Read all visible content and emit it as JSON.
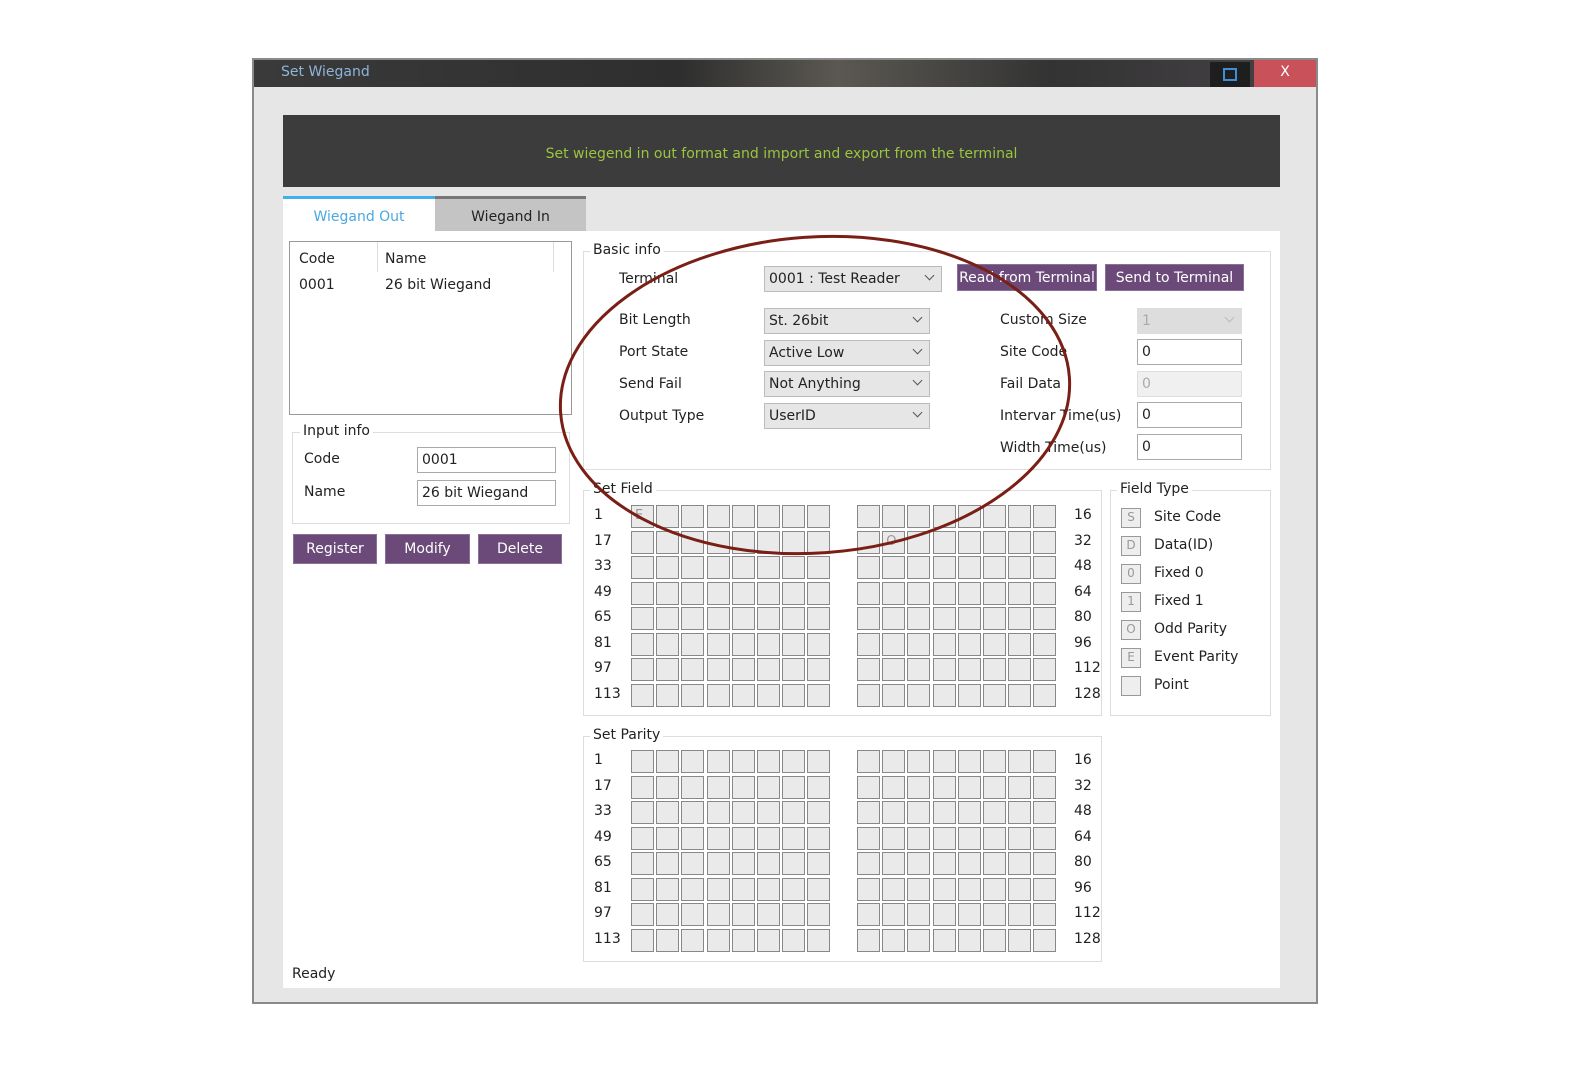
{
  "window": {
    "title": "Set Wiegand",
    "close_label": "X"
  },
  "header": {
    "text": "Set wiegend in  out format and import and export from the terminal"
  },
  "tabs": [
    {
      "label": "Wiegand Out",
      "active": true
    },
    {
      "label": "Wiegand In",
      "active": false
    }
  ],
  "list": {
    "columns": [
      "Code",
      "Name"
    ],
    "rows": [
      {
        "code": "0001",
        "name": "26 bit Wiegand"
      }
    ]
  },
  "input_info": {
    "legend": "Input info",
    "code_label": "Code",
    "code_value": "0001",
    "name_label": "Name",
    "name_value": "26 bit Wiegand"
  },
  "actions": {
    "register": "Register",
    "modify": "Modify",
    "delete": "Delete"
  },
  "basic_info": {
    "legend": "Basic info",
    "terminal_label": "Terminal",
    "terminal_value": "0001 : Test Reader",
    "read_button": "Read from Terminal",
    "send_button": "Send to Terminal",
    "bit_length_label": "Bit Length",
    "bit_length_value": "St. 26bit",
    "port_state_label": "Port State",
    "port_state_value": "Active Low",
    "send_fail_label": "Send Fail",
    "send_fail_value": "Not Anything",
    "output_type_label": "Output Type",
    "output_type_value": "UserID",
    "custom_size_label": "Custom Size",
    "custom_size_value": "1",
    "site_code_label": "Site Code",
    "site_code_value": "0",
    "fail_data_label": "Fail Data",
    "fail_data_value": "0",
    "interval_label": "Intervar Time(us)",
    "interval_value": "0",
    "width_label": "Width Time(us)",
    "width_value": "0"
  },
  "set_field": {
    "legend": "Set Field",
    "left_numbers": [
      "1",
      "17",
      "33",
      "49",
      "65",
      "81",
      "97",
      "113"
    ],
    "right_numbers": [
      "16",
      "32",
      "48",
      "64",
      "80",
      "96",
      "112",
      "128"
    ],
    "cells": [
      [
        "E",
        "",
        "",
        "",
        "",
        "",
        "",
        "",
        "",
        "",
        "",
        "",
        "",
        "",
        "",
        ""
      ],
      [
        "",
        "",
        "",
        "",
        "",
        "",
        "",
        "",
        "",
        "O",
        "",
        "",
        "",
        "",
        "",
        ""
      ],
      [],
      [],
      [],
      [],
      [],
      []
    ]
  },
  "set_parity": {
    "legend": "Set Parity",
    "left_numbers": [
      "1",
      "17",
      "33",
      "49",
      "65",
      "81",
      "97",
      "113"
    ],
    "right_numbers": [
      "16",
      "32",
      "48",
      "64",
      "80",
      "96",
      "112",
      "128"
    ]
  },
  "field_type": {
    "legend": "Field Type",
    "items": [
      {
        "glyph": "S",
        "label": "Site Code"
      },
      {
        "glyph": "D",
        "label": "Data(ID)"
      },
      {
        "glyph": "0",
        "label": "Fixed 0"
      },
      {
        "glyph": "1",
        "label": "Fixed 1"
      },
      {
        "glyph": "O",
        "label": "Odd Parity"
      },
      {
        "glyph": "E",
        "label": "Event Parity"
      },
      {
        "glyph": "",
        "label": "Point"
      }
    ]
  },
  "status": {
    "text": "Ready"
  },
  "annotation": {
    "color": "#7a1f16",
    "shape": "ellipse"
  }
}
